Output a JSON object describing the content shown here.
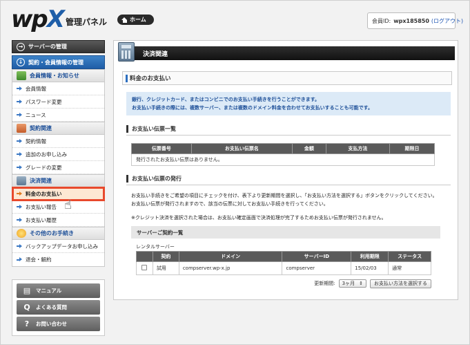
{
  "header": {
    "logo_main": "wp",
    "logo_x": "X",
    "panel_title": "管理パネル",
    "home_label": "ホーム",
    "member_label": "会員ID:",
    "member_id": "wpx185850",
    "logout_label": "(ログアウト)"
  },
  "sidebar": {
    "server_manage": "サーバーの管理",
    "contract_manage": "契約・会員情報の管理",
    "categories": [
      {
        "label": "会員情報・お知らせ",
        "items": [
          "会員情報",
          "パスワード変更",
          "ニュース"
        ]
      },
      {
        "label": "契約関連",
        "items": [
          "契約情報",
          "追加のお申し込み",
          "グレードの変更"
        ]
      },
      {
        "label": "決済関連",
        "items": [
          "料金のお支払い",
          "お支払い報告",
          "お支払い履歴"
        ]
      },
      {
        "label": "その他のお手続き",
        "items": [
          "バックアップデータお申し込み",
          "退会・解約"
        ]
      }
    ],
    "help": [
      "マニュアル",
      "よくある質問",
      "お問い合わせ"
    ]
  },
  "main": {
    "title": "決済関連",
    "section_title": "料金のお支払い",
    "notice_line1": "銀行、クレジットカード、またはコンビニでのお支払い手続きを行うことができます。",
    "notice_line2": "お支払い手続きの際には、複数サーバー、または複数のドメイン料金を合わせてお支払いすることも可能です。",
    "slip_list_title": "お支払い伝票一覧",
    "slip_headers": [
      "伝票番号",
      "お支払い伝票名",
      "金額",
      "支払方法",
      "期限日"
    ],
    "slip_empty": "発行されたお支払い伝票はありません。",
    "issue_title": "お支払い伝票の発行",
    "issue_text1": "お支払い手続きをご希望の項目にチェックを付け、表下より更新期間を選択し、「お支払い方法を選択する」ボタンをクリックしてください。",
    "issue_text2": "お支払い伝票が発行されますので、該当の伝票に対してお支払い手続きを行ってください。",
    "credit_note": "※クレジット決済を選択された場合は、お支払い確定画面で決済処理が完了するためお支払い伝票が発行されません。",
    "contract_list_title": "サーバーご契約一覧",
    "rental_label": "レンタルサーバー",
    "contract_headers": [
      "",
      "契約",
      "ドメイン",
      "サーバーID",
      "利用期限",
      "ステータス"
    ],
    "contract_row": {
      "type": "試用",
      "domain": "compserver.wp-x.jp",
      "server_id": "compserver",
      "expiry": "15/02/03",
      "status": "通常"
    },
    "period_label": "更新期間:",
    "period_value": "3ヶ月",
    "pay_button": "お支払い方法を選択する"
  },
  "colors": {
    "accent_blue": "#1f5da6",
    "active_outline": "#e8492c"
  }
}
